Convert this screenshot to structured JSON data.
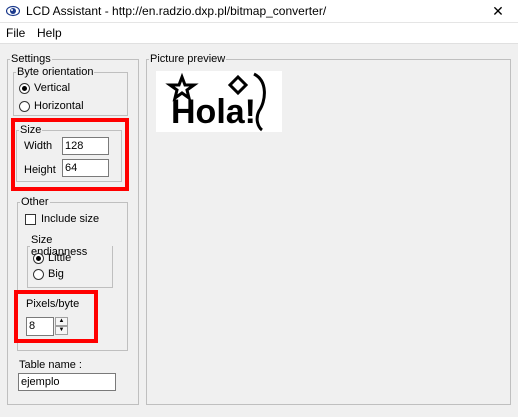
{
  "window": {
    "title": "LCD Assistant -  http://en.radzio.dxp.pl/bitmap_converter/",
    "close_glyph": "✕"
  },
  "menu": {
    "file": "File",
    "help": "Help"
  },
  "settings": {
    "legend": "Settings",
    "byte_orientation": {
      "legend": "Byte orientation",
      "vertical_label": "Vertical",
      "horizontal_label": "Horizontal",
      "selected": "Vertical"
    },
    "size": {
      "legend": "Size",
      "width_label": "Width",
      "width_value": "128",
      "height_label": "Height",
      "height_value": "64"
    },
    "other": {
      "legend": "Other",
      "include_size_label": "Include size",
      "include_size_checked": false,
      "size_endianness": {
        "legend": "Size endianness",
        "little_label": "Little",
        "big_label": "Big",
        "selected": "Little"
      },
      "pixels_per_byte": {
        "label": "Pixels/byte",
        "value": "8"
      }
    },
    "table_name": {
      "label": "Table name :",
      "value": "ejemplo"
    }
  },
  "preview": {
    "legend": "Picture preview",
    "text": "Hola!"
  },
  "colors": {
    "highlight": "#ff0000",
    "background": "#f0f0f0"
  }
}
